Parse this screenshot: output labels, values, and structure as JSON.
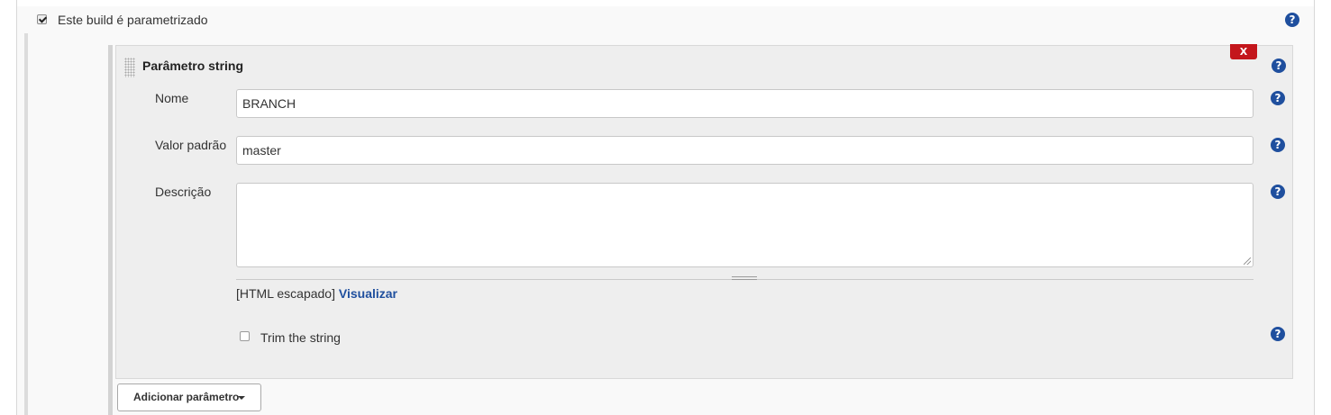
{
  "build_section": {
    "parameterized_checkbox_label": "Este build é parametrizado",
    "parameterized_checked": true,
    "help_icon_glyph": "?"
  },
  "string_parameter": {
    "title": "Parâmetro string",
    "delete_label": "X",
    "name_label": "Nome",
    "name_value": "BRANCH",
    "default_value_label": "Valor padrão",
    "default_value": "master",
    "description_label": "Descrição",
    "description_value": "",
    "html_escaped_text": "[HTML escapado]",
    "preview_link": "Visualizar",
    "trim_label": "Trim the string",
    "trim_checked": false
  },
  "add_parameter_button": "Adicionar parâmetro",
  "colors": {
    "help_icon": "#1f4f9e",
    "delete_button": "#c4161c",
    "link": "#1f4f9e"
  },
  "icons": [
    "help-icon",
    "drag-handle-icon",
    "caret-down-icon"
  ]
}
